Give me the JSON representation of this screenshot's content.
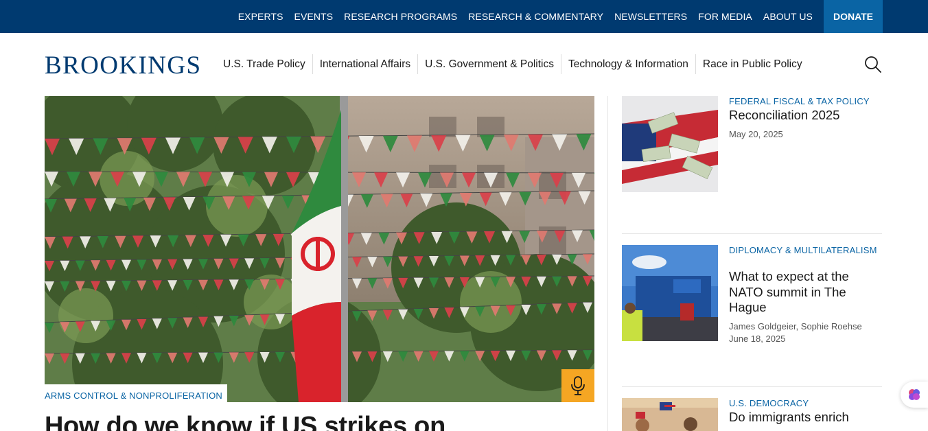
{
  "topnav": {
    "items": [
      "EXPERTS",
      "EVENTS",
      "RESEARCH PROGRAMS",
      "RESEARCH & COMMENTARY",
      "NEWSLETTERS",
      "FOR MEDIA",
      "ABOUT US"
    ],
    "donate": "DONATE"
  },
  "header": {
    "logo": "BROOKINGS",
    "nav": [
      "U.S. Trade Policy",
      "International Affairs",
      "U.S. Government & Politics",
      "Technology & Information",
      "Race in Public Policy"
    ],
    "search_icon": "search-icon"
  },
  "hero": {
    "category": "ARMS CONTROL & NONPROLIFERATION",
    "headline": "How do we know if US strikes on",
    "badge_icon": "microphone-icon"
  },
  "sidebar": {
    "cards": [
      {
        "category": "FEDERAL FISCAL & TAX POLICY",
        "title": "Reconciliation 2025",
        "authors": "",
        "date": "May 20, 2025"
      },
      {
        "category": "DIPLOMACY & MULTILATERALISM",
        "title": "What to expect at the NATO summit in The Hague",
        "authors": "James Goldgeier, Sophie Roehse",
        "date": "June 18, 2025"
      },
      {
        "category": "U.S. DEMOCRACY",
        "title": "Do immigrants enrich",
        "authors": "",
        "date": ""
      }
    ]
  },
  "colors": {
    "brand": "#003a70",
    "accent": "#0a64a4",
    "badge": "#f5a623"
  }
}
